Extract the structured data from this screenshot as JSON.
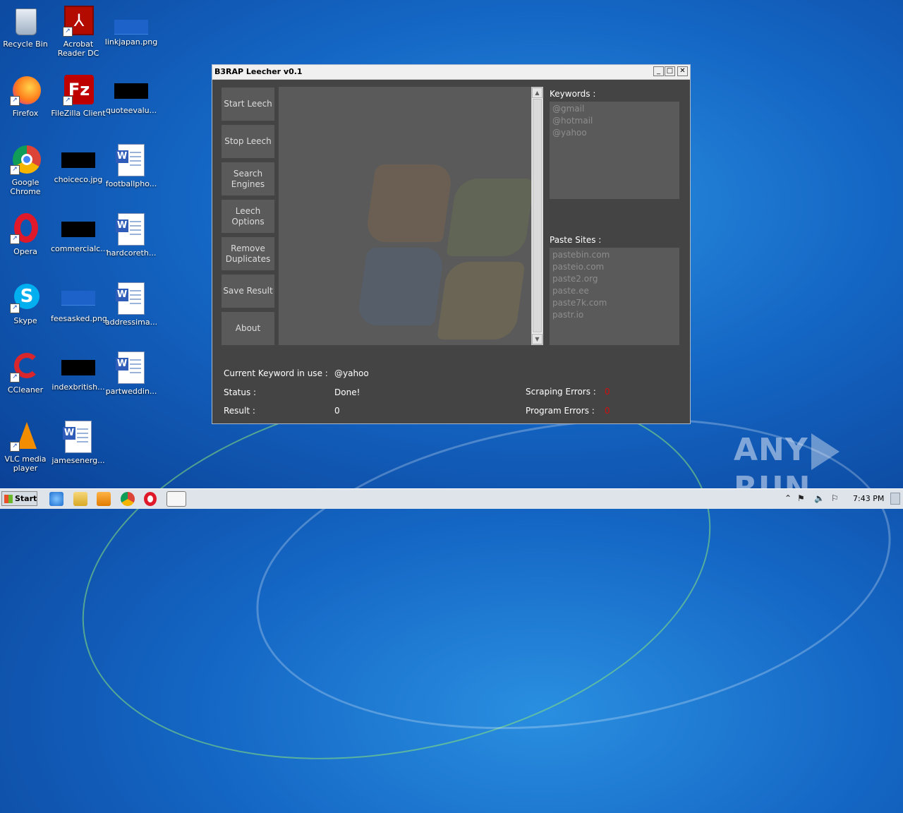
{
  "desktop": {
    "icons": [
      {
        "label": "Recycle Bin"
      },
      {
        "label": "Acrobat Reader DC"
      },
      {
        "label": "linkjapan.png"
      },
      {
        "label": "Firefox"
      },
      {
        "label": "FileZilla Client"
      },
      {
        "label": "quoteevalu..."
      },
      {
        "label": "Google Chrome"
      },
      {
        "label": "choiceco.jpg"
      },
      {
        "label": "footballpho..."
      },
      {
        "label": "Opera"
      },
      {
        "label": "commercialc..."
      },
      {
        "label": "hardcoreth..."
      },
      {
        "label": "Skype"
      },
      {
        "label": "feesasked.png"
      },
      {
        "label": "addressima..."
      },
      {
        "label": "CCleaner"
      },
      {
        "label": "indexbritish..."
      },
      {
        "label": "partweddin..."
      },
      {
        "label": "VLC media player"
      },
      {
        "label": "jamesenerg..."
      }
    ]
  },
  "window": {
    "title": "B3RAP Leecher v0.1",
    "buttons": [
      {
        "label": "Start Leech"
      },
      {
        "label": "Stop Leech"
      },
      {
        "label": "Search Engines"
      },
      {
        "label": "Leech Options"
      },
      {
        "label": "Remove Duplicates"
      },
      {
        "label": "Save Result"
      },
      {
        "label": "About"
      }
    ],
    "keywords_label": "Keywords :",
    "keywords": [
      "@gmail",
      "@hotmail",
      "@yahoo"
    ],
    "paste_sites_label": "Paste Sites :",
    "paste_sites": [
      "pastebin.com",
      "pasteio.com",
      "paste2.org",
      "paste.ee",
      "paste7k.com",
      "pastr.io"
    ],
    "current_keyword_label": "Current Keyword in use :",
    "current_keyword": "@yahoo",
    "status_label": "Status :",
    "status": "Done!",
    "result_label": "Result :",
    "result": "0",
    "scraping_errors_label": "Scraping Errors :",
    "scraping_errors": "0",
    "program_errors_label": "Program Errors :",
    "program_errors": "0"
  },
  "watermark": {
    "left": "ANY",
    "right": "RUN"
  },
  "taskbar": {
    "start_label": "Start",
    "clock": "7:43 PM"
  }
}
